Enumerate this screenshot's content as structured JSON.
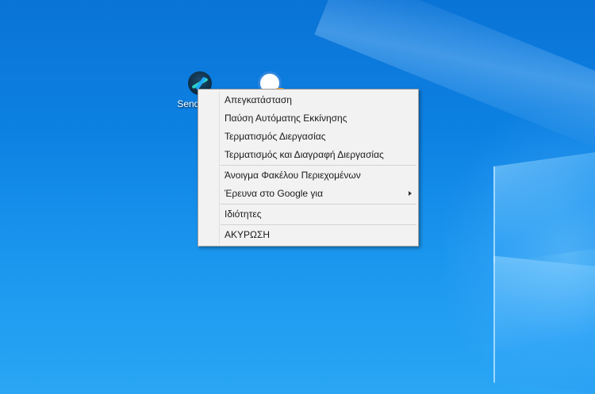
{
  "desktop": {
    "icons": [
      {
        "label": "Send Fi",
        "icon": "send-app-icon"
      },
      {
        "label": "",
        "icon": "shortcut-app-icon"
      }
    ]
  },
  "context_menu": {
    "groups": [
      [
        {
          "label": "Απεγκατάσταση"
        },
        {
          "label": "Παύση Αυτόματης Εκκίνησης"
        },
        {
          "label": "Τερματισμός Διεργασίας"
        },
        {
          "label": "Τερματισμός και Διαγραφή Διεργασίας"
        }
      ],
      [
        {
          "label": "Άνοιγμα Φακέλου Περιεχομένων"
        },
        {
          "label": "Έρευνα στο Google για",
          "submenu": true
        }
      ],
      [
        {
          "label": "Ιδιότητες"
        }
      ],
      [
        {
          "label": "ΑΚΥΡΩΣΗ"
        }
      ]
    ],
    "submenu_icon": "chevron-right-icon"
  },
  "colors": {
    "desktop_blue": "#0d82e3",
    "menu_bg": "#f2f2f2",
    "menu_border": "#a0a0a0",
    "menu_text": "#1a1a1a"
  }
}
